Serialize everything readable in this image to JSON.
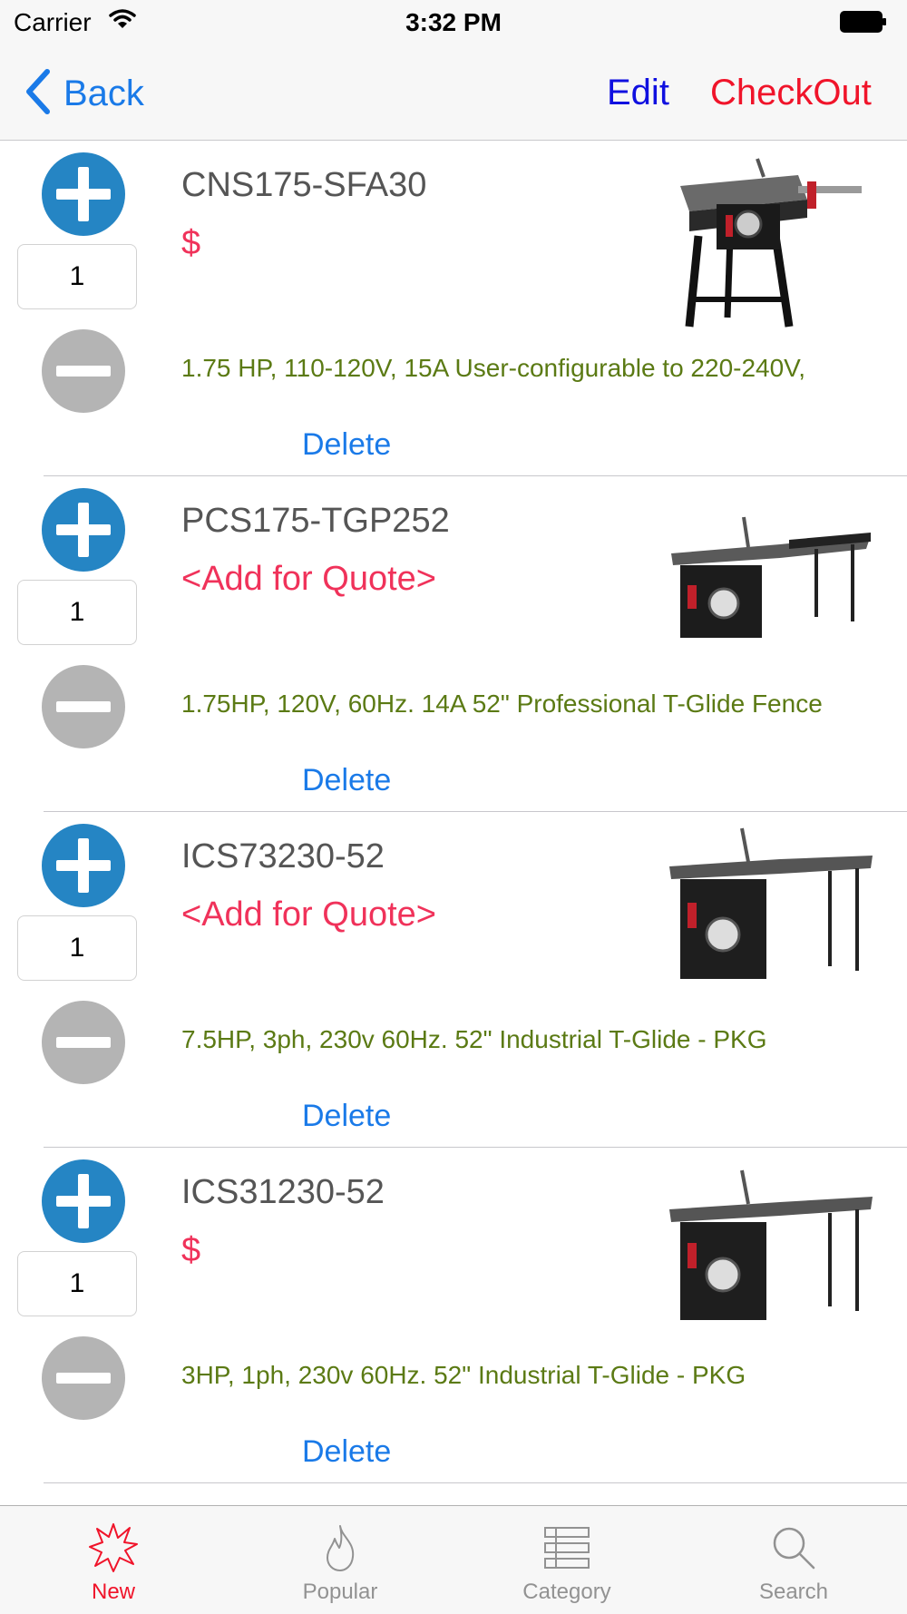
{
  "status_bar": {
    "carrier": "Carrier",
    "time": "3:32 PM"
  },
  "nav": {
    "back_label": "Back",
    "edit_label": "Edit",
    "checkout_label": "CheckOut"
  },
  "cart_items": [
    {
      "name": "CNS175-SFA30",
      "price": "$",
      "quantity": "1",
      "description": "1.75 HP, 110-120V, 15A User-configurable to 220-240V,",
      "delete_label": "Delete"
    },
    {
      "name": "PCS175-TGP252",
      "price": "<Add for Quote>",
      "quantity": "1",
      "description": "1.75HP, 120V, 60Hz. 14A 52\" Professional T-Glide Fence",
      "delete_label": "Delete"
    },
    {
      "name": "ICS73230-52",
      "price": "<Add for Quote>",
      "quantity": "1",
      "description": "7.5HP, 3ph, 230v 60Hz. 52\" Industrial T-Glide - PKG",
      "delete_label": "Delete"
    },
    {
      "name": "ICS31230-52",
      "price": "$",
      "quantity": "1",
      "description": "3HP, 1ph, 230v 60Hz. 52\" Industrial T-Glide - PKG",
      "delete_label": "Delete"
    }
  ],
  "tab_bar": {
    "tabs": [
      {
        "label": "New",
        "icon": "new-star-icon",
        "active": true
      },
      {
        "label": "Popular",
        "icon": "flame-icon",
        "active": false
      },
      {
        "label": "Category",
        "icon": "list-icon",
        "active": false
      },
      {
        "label": "Search",
        "icon": "search-icon",
        "active": false
      }
    ]
  },
  "colors": {
    "accent_blue": "#1a7ae8",
    "edit_blue": "#1010e0",
    "checkout_red": "#f0142a",
    "price_red": "#f0325a",
    "description_green": "#5b7a14",
    "plus_blue": "#2585c4",
    "minus_gray": "#b4b4b4"
  }
}
